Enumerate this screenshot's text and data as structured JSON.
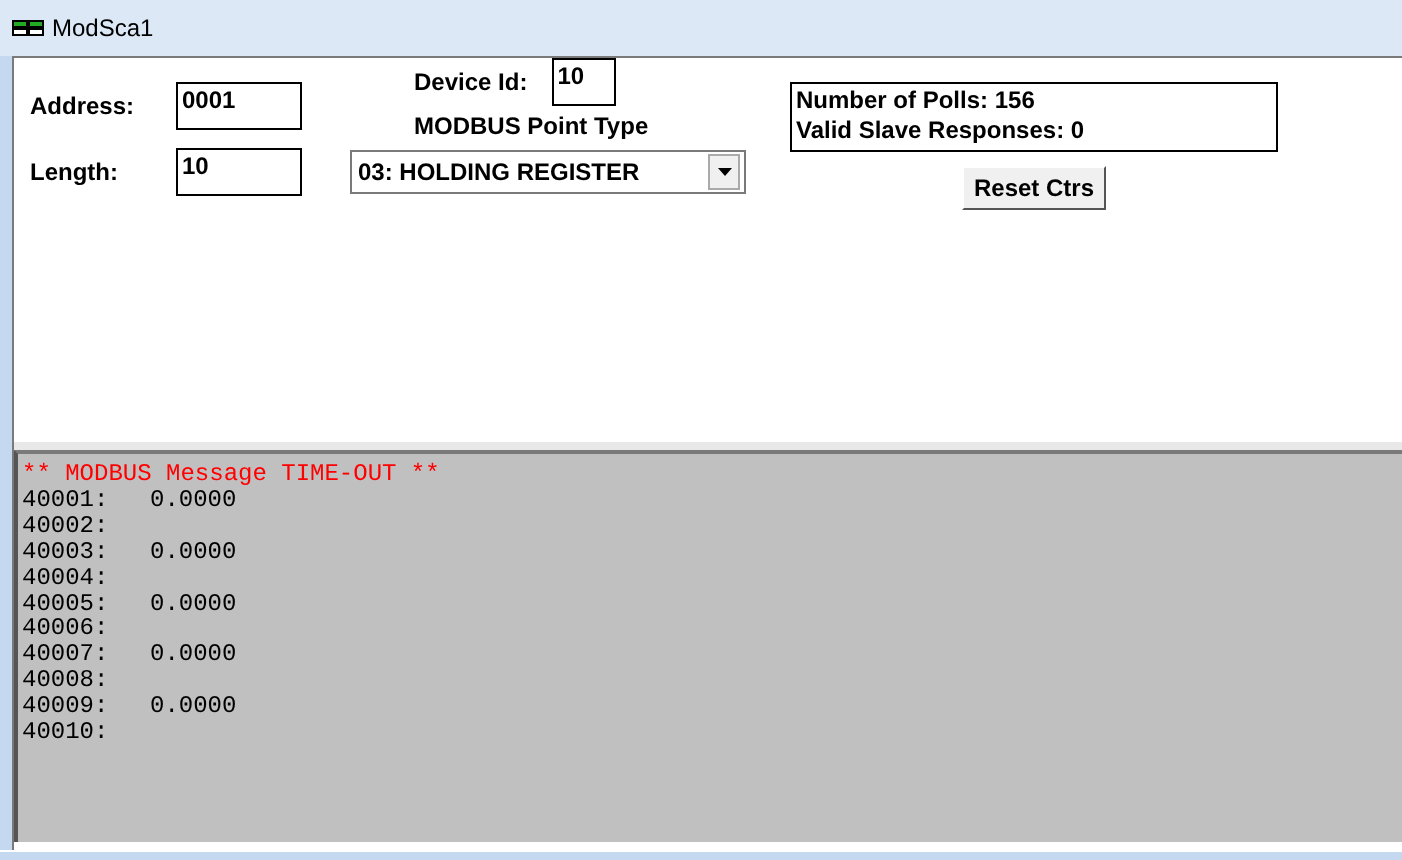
{
  "window": {
    "title": "ModSca1"
  },
  "address": {
    "label": "Address:",
    "value": "0001"
  },
  "length": {
    "label": "Length:",
    "value": "10"
  },
  "device_id": {
    "label": "Device Id:",
    "value": "10"
  },
  "point_type": {
    "label": "MODBUS Point Type",
    "value": "03: HOLDING REGISTER"
  },
  "counters": [
    "Number of Polls: 156",
    "Valid Slave Responses: 0"
  ],
  "reset_button": "Reset Ctrs",
  "log": {
    "header": "** MODBUS Message TIME-OUT **",
    "rows": [
      {
        "address": "40001:",
        "value": "0.0000"
      },
      {
        "address": "40002:"
      },
      {
        "address": "40003:",
        "value": "0.0000"
      },
      {
        "address": "40004:"
      },
      {
        "address": "40005:",
        "value": "0.0000"
      },
      {
        "address": "40006:"
      },
      {
        "address": "40007:",
        "value": "0.0000"
      },
      {
        "address": "40008:"
      },
      {
        "address": "40009:",
        "value": "0.0000"
      },
      {
        "address": "40010:"
      }
    ]
  }
}
